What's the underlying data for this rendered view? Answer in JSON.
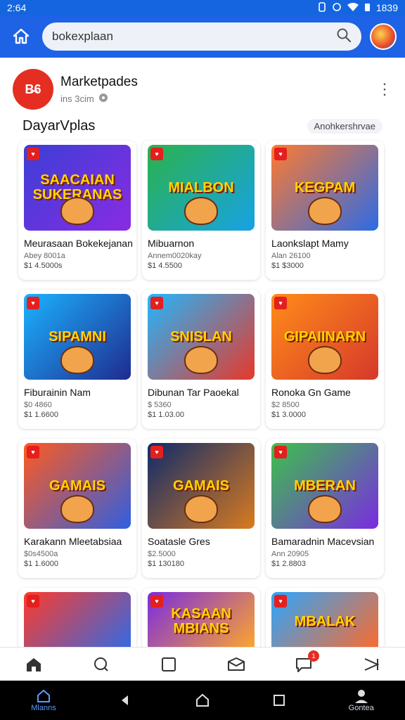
{
  "status_bar": {
    "time": "2:64",
    "right_text": "1839",
    "icons": [
      "notification-icon",
      "circle-icon",
      "wifi-icon",
      "battery-icon"
    ]
  },
  "app_bar": {
    "search_value": "bokexplaan",
    "icons": [
      "home-icon",
      "search-icon",
      "profile-avatar"
    ]
  },
  "header": {
    "logo_text": "B̶6",
    "name": "Marketpades",
    "sub": "ins 3cim"
  },
  "section": {
    "title": "DayarVplas",
    "chip": "Anohkershrvae"
  },
  "cards": [
    {
      "art": "SAACAIAN SUKERANAS",
      "title": "Meurasaan Bokekejanan",
      "meta": "Abey 8001a",
      "price": "$1 4.5000s",
      "bg": [
        "#3b3fd6",
        "#8a2be2"
      ]
    },
    {
      "art": "MIALBON",
      "title": "Mibuarnon",
      "meta": "Annem0020kay",
      "price": "$1 4.5500",
      "bg": [
        "#2bb24c",
        "#17a2e5"
      ]
    },
    {
      "art": "KEGPAM",
      "title": "Laonkslapt Mamy",
      "meta": "Alan 26100",
      "price": "$1 $3000",
      "bg": [
        "#ff7a2f",
        "#2c6be6"
      ]
    },
    {
      "art": "SIPAMNI",
      "title": "Fiburainin Nam",
      "meta": "$0 4860",
      "price": "$1 1.6600",
      "bg": [
        "#1bb3ff",
        "#1f2b8f"
      ]
    },
    {
      "art": "SNISLAN",
      "title": "Dibunan Tar Paoekal",
      "meta": "$ 5360",
      "price": "$1 1.03.00",
      "bg": [
        "#20b7ff",
        "#e8382a"
      ]
    },
    {
      "art": "GIPAIINARN",
      "title": "Ronoka Gn Game",
      "meta": "$2 8500",
      "price": "$1 3.0000",
      "bg": [
        "#ff8c1a",
        "#d6392a"
      ]
    },
    {
      "art": "GAMAIS",
      "title": "Karakann Mleetabsiaa",
      "meta": "$0s4500a",
      "price": "$1 1.6000",
      "bg": [
        "#ff5a1f",
        "#2f5fe0"
      ]
    },
    {
      "art": "GAMAIS",
      "title": "Soatasle Gres",
      "meta": "$2.5000",
      "price": "$1 130180",
      "bg": [
        "#0e2a6b",
        "#d97b1f"
      ]
    },
    {
      "art": "MBERAN",
      "title": "Bamaradnin Macevsian",
      "meta": "Ann 20905",
      "price": "$1 2.8803",
      "bg": [
        "#3cc24a",
        "#7a2be2"
      ]
    },
    {
      "art": "",
      "title": "",
      "meta": "",
      "price": "",
      "bg": [
        "#ff3a2a",
        "#2f6be6"
      ]
    },
    {
      "art": "KASAAN MBIANS",
      "title": "",
      "meta": "",
      "price": "",
      "bg": [
        "#7a2be2",
        "#ffa72a"
      ]
    },
    {
      "art": "MBALAK",
      "title": "",
      "meta": "",
      "price": "",
      "bg": [
        "#2aa6ff",
        "#ff6a2a"
      ]
    }
  ],
  "bottom_nav": {
    "items": [
      "home-icon",
      "search-icon",
      "square-icon",
      "mail-icon",
      "chat-icon",
      "arrow-icon"
    ],
    "badge": "1"
  },
  "system_bar": {
    "left_label": "Mlanns",
    "right_label": "Gontea"
  },
  "colors": {
    "accent": "#1e63e6",
    "brand_red": "#e52e22"
  }
}
